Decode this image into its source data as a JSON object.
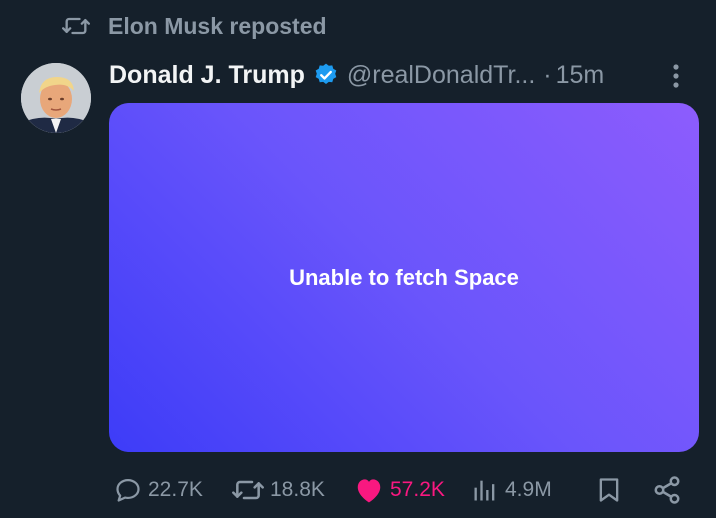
{
  "repost": {
    "text": "Elon Musk reposted",
    "icon": "repost-icon"
  },
  "author": {
    "name": "Donald J. Trump",
    "handle": "@realDonaldTr...",
    "separator": "·",
    "time": "15m",
    "verified": true,
    "verified_color": "#1d9bf0"
  },
  "card": {
    "message": "Unable to fetch Space",
    "gradient": [
      "#3d3cf8",
      "#6a55fb",
      "#8d5cfd"
    ]
  },
  "actions": {
    "replies": "22.7K",
    "reposts": "18.8K",
    "likes": "57.2K",
    "views": "4.9M"
  },
  "colors": {
    "background": "#15202b",
    "muted": "#8b98a5",
    "like": "#f91880"
  }
}
